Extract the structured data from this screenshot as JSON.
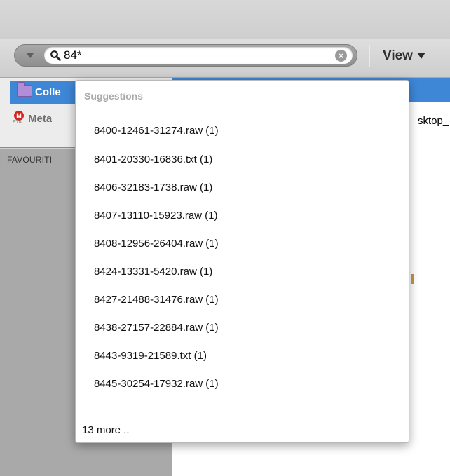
{
  "toolbar": {
    "search_query": "84*",
    "view_label": "View"
  },
  "sidebar": {
    "items": [
      {
        "label": "Colle",
        "icon": "folder-icon",
        "selected": true
      },
      {
        "label": "Meta",
        "icon": "meta-icon",
        "badge": "M",
        "sub": "ETA"
      }
    ],
    "section_label": "FAVOURITI"
  },
  "content": {
    "visible_text": "sktop_"
  },
  "suggestions": {
    "header": "Suggestions",
    "items": [
      "8400-12461-31274.raw (1)",
      "8401-20330-16836.txt (1)",
      "8406-32183-1738.raw (1)",
      "8407-13110-15923.raw (1)",
      "8408-12956-26404.raw (1)",
      "8424-13331-5420.raw (1)",
      "8427-21488-31476.raw (1)",
      "8438-27157-22884.raw (1)",
      "8443-9319-21589.txt (1)",
      "8445-30254-17932.raw (1)"
    ],
    "more_label": "13 more .."
  },
  "colors": {
    "selection_blue": "#3e86d6",
    "sidebar_grey": "#a9a9a9",
    "toolbar_grey": "#d6d6d6"
  }
}
